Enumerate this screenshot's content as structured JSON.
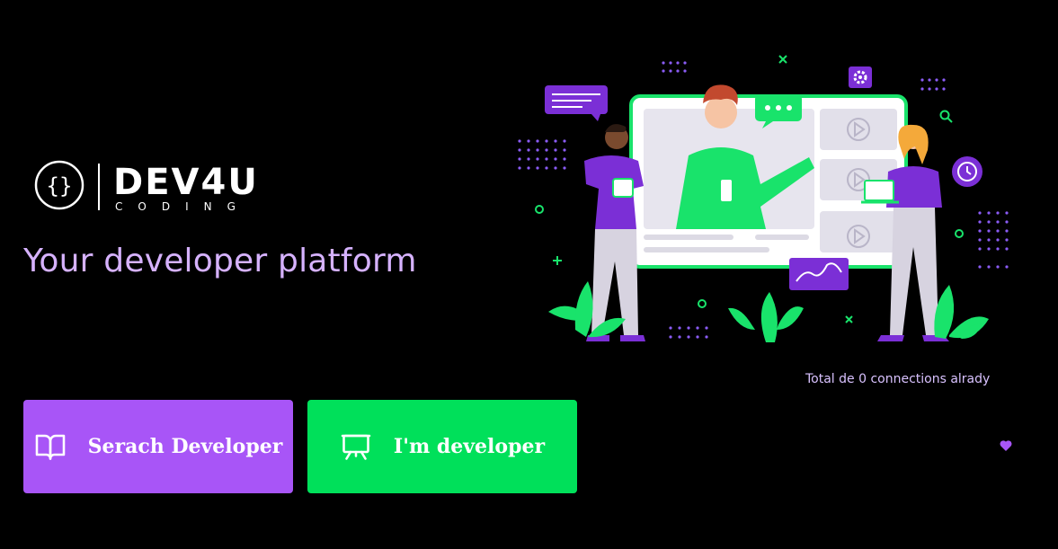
{
  "brand": {
    "wordmark": "DEV4U",
    "sub": "CODING"
  },
  "hero": {
    "tagline": "Your developer platform"
  },
  "stats": {
    "connections_text": "Total de 0 connections alrady"
  },
  "actions": {
    "search_label": "Serach Developer",
    "search_icon": "book-open-icon",
    "developer_label": "I'm developer",
    "developer_icon": "presentation-icon"
  },
  "colors": {
    "background": "#000000",
    "purple": "#a855f7",
    "green": "#00e05a",
    "tagline": "#d6b2ff"
  }
}
